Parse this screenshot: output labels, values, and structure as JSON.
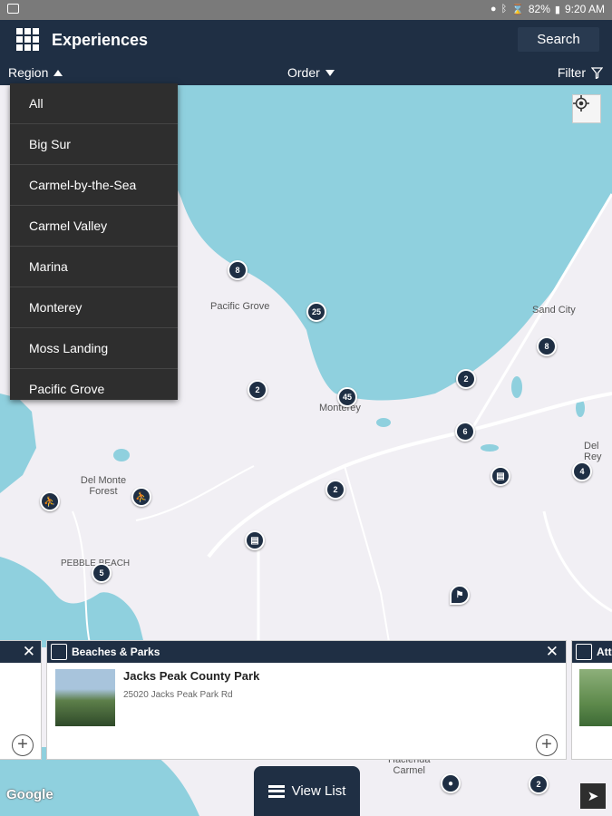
{
  "status_bar": {
    "battery": "82%",
    "time": "9:20 AM"
  },
  "app_bar": {
    "title": "Experiences",
    "search_label": "Search"
  },
  "filter_bar": {
    "region_label": "Region",
    "order_label": "Order",
    "filter_label": "Filter"
  },
  "region_dropdown": {
    "items": [
      "All",
      "Big Sur",
      "Carmel-by-the-Sea",
      "Carmel Valley",
      "Marina",
      "Monterey",
      "Moss Landing",
      "Pacific Grove"
    ]
  },
  "map": {
    "labels": {
      "pacific_grove": "Pacific Grove",
      "monterey": "Monterey",
      "sand_city": "Sand City",
      "del_monte_forest": "Del Monte\nForest",
      "pebble_beach": "PEBBLE BEACH",
      "del_rey": "Del Rey",
      "hacienda_carmel": "Hacienda\nCarmel"
    },
    "clusters": [
      "8",
      "25",
      "8",
      "2",
      "45",
      "2",
      "6",
      "4",
      "2",
      "5",
      "2"
    ],
    "attribution": "Google"
  },
  "cards": [
    {
      "category": "Beaches & Parks",
      "title": "Jacks Peak County Park",
      "address": "25020 Jacks Peak Park Rd"
    },
    {
      "category": "Att"
    }
  ],
  "view_list_label": "View List",
  "colors": {
    "navy": "#1f2f44",
    "water": "#8fd0de",
    "land": "#f1eff4",
    "menu": "#2e2e2e"
  }
}
